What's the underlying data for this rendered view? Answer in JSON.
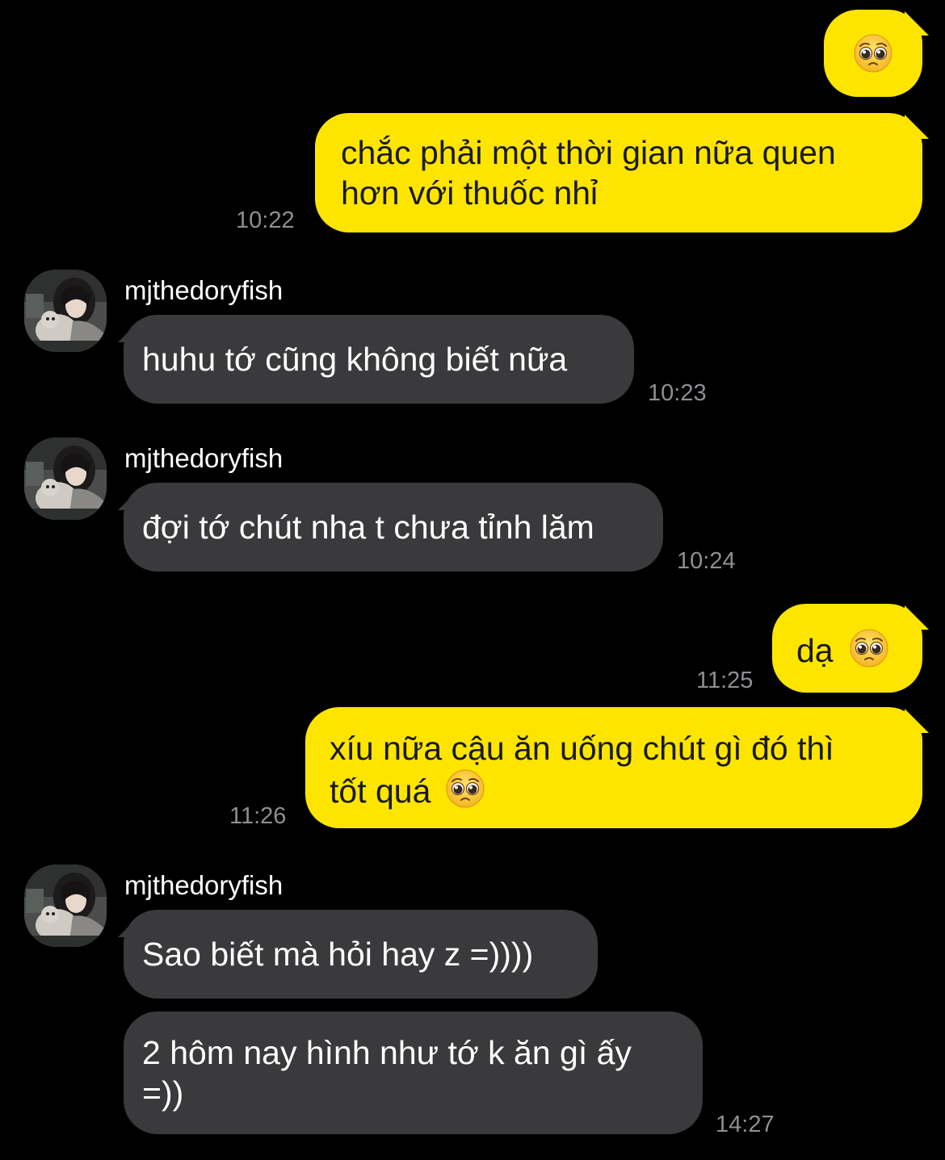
{
  "chat": {
    "contact_name": "mjthedoryfish",
    "colors": {
      "background": "#000000",
      "outgoing_bubble": "#FEE500",
      "incoming_bubble": "#3A3A3C",
      "timestamp": "#8E8E93"
    },
    "messages": [
      {
        "id": "m1",
        "direction": "outgoing",
        "text": "",
        "emoji": "pleading-face-emoji",
        "time": ""
      },
      {
        "id": "m2",
        "direction": "outgoing",
        "lines": [
          "chắc phải một thời gian nữa quen",
          "hơn với thuốc nhỉ"
        ],
        "time": "10:22"
      },
      {
        "id": "m3",
        "direction": "incoming",
        "sender": "mjthedoryfish",
        "text": "huhu tớ cũng không biết nữa",
        "time": "10:23"
      },
      {
        "id": "m4",
        "direction": "incoming",
        "sender": "mjthedoryfish",
        "text": "đợi tớ chút nha t chưa tỉnh lăm",
        "time": "10:24"
      },
      {
        "id": "m5",
        "direction": "outgoing",
        "text": "dạ",
        "emoji": "pleading-face-emoji",
        "time": "11:25"
      },
      {
        "id": "m6",
        "direction": "outgoing",
        "lines": [
          "xíu nữa cậu ăn uống chút gì đó thì",
          "tốt quá"
        ],
        "emoji": "pleading-face-emoji",
        "time": "11:26"
      },
      {
        "id": "m7",
        "direction": "incoming",
        "sender": "mjthedoryfish",
        "text": "Sao biết mà hỏi hay z =))))",
        "time": ""
      },
      {
        "id": "m8",
        "direction": "incoming",
        "lines": [
          "2 hôm nay hình như tớ k ăn gì ấy",
          "=))"
        ],
        "time": "14:27"
      }
    ]
  }
}
